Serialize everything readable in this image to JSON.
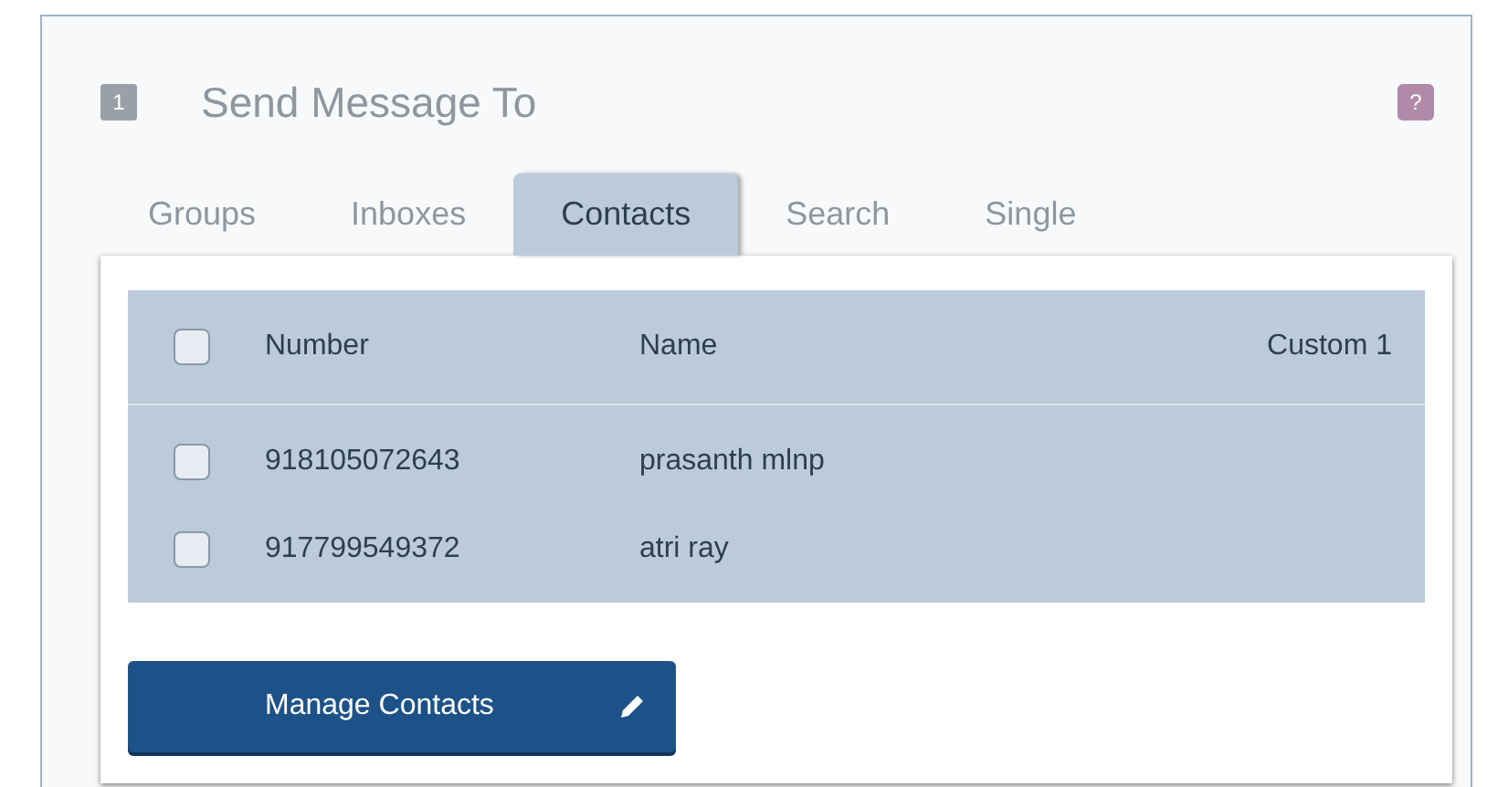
{
  "step": {
    "number": "1",
    "title": "Send Message To",
    "help": "?"
  },
  "tabs": [
    {
      "label": "Groups",
      "selected": false
    },
    {
      "label": "Inboxes",
      "selected": false
    },
    {
      "label": "Contacts",
      "selected": true
    },
    {
      "label": "Search",
      "selected": false
    },
    {
      "label": "Single",
      "selected": false
    }
  ],
  "table": {
    "select_all": {
      "checked": false
    },
    "columns": [
      "Number",
      "Name",
      "Custom 1"
    ],
    "rows": [
      {
        "checked": false,
        "number": "918105072643",
        "name": "prasanth mlnp"
      },
      {
        "checked": false,
        "number": "917799549372",
        "name": "atri ray"
      }
    ]
  },
  "manage_button": {
    "label": "Manage Contacts"
  }
}
